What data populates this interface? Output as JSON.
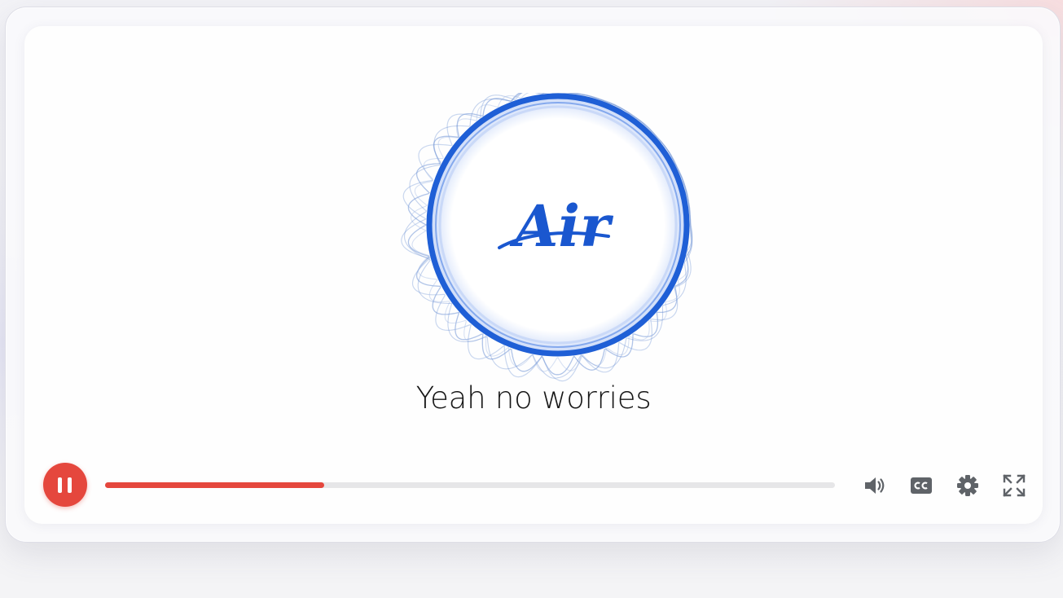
{
  "player": {
    "logo_text": "Air",
    "caption": "Yeah no worries",
    "playback_state": "playing",
    "progress": 0.3,
    "colors": {
      "accent": "#e5473d",
      "logo_blue": "#1f5fd6",
      "control_gray": "#5f6368"
    },
    "icons": {
      "pause": "pause-icon",
      "volume": "volume-icon",
      "captions": "closed-captions-icon",
      "settings": "gear-icon",
      "fullscreen": "fullscreen-icon"
    }
  }
}
